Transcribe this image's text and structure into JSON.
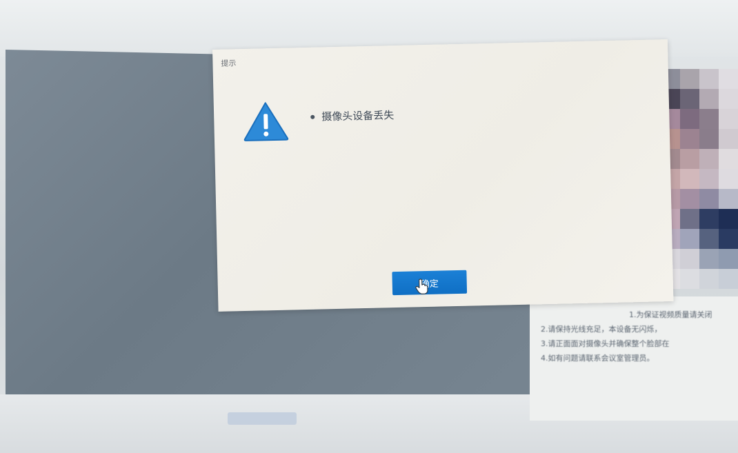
{
  "dialog": {
    "title": "提示",
    "message": "摄像头设备丢失",
    "ok_button_label": "确定",
    "warning_icon": "warning-triangle-icon",
    "accent_color": "#1a7fd6"
  },
  "background": {
    "notes": [
      "1.为保证视频质量请关闭",
      "2.请保持光线充足，本设备无闪烁，",
      "3.请正面面对摄像头并确保整个脸部在",
      "4.如有问题请联系会议室管理员。"
    ]
  },
  "mosaic_colors": [
    [
      "#7c7f8e",
      "#8d8e9a",
      "#a9a4ab",
      "#c9c4cb",
      "#e0dde2"
    ],
    [
      "#8f7f86",
      "#4a4556",
      "#6b6576",
      "#b3aab3",
      "#dcd8dd"
    ],
    [
      "#b89a97",
      "#a5899c",
      "#7d6b7f",
      "#8b7e8c",
      "#d8d3d8"
    ],
    [
      "#c8a59e",
      "#b7928f",
      "#9c8391",
      "#8a7d8b",
      "#d0cad0"
    ],
    [
      "#c9a7a2",
      "#a28a8f",
      "#b99ea3",
      "#bfb0b8",
      "#e0dcdf"
    ],
    [
      "#b89ba0",
      "#c4a5a7",
      "#d2b8bb",
      "#c5b8c2",
      "#dedbe0"
    ],
    [
      "#a98ea3",
      "#b79aa6",
      "#a38fa3",
      "#8f8ba3",
      "#b7b9c8"
    ],
    [
      "#caa8b4",
      "#c0a5b4",
      "#6f7088",
      "#2e3d62",
      "#1e2e55"
    ],
    [
      "#dcd0d8",
      "#b9adc0",
      "#a0a4ba",
      "#56627f",
      "#2a3b62"
    ],
    [
      "#e3dfe3",
      "#d9d7dd",
      "#d0cfd6",
      "#9aa3b5",
      "#8f9bb0"
    ],
    [
      "#e6e4e6",
      "#e3e1e4",
      "#dcdde1",
      "#d0d4da",
      "#c8ced7"
    ]
  ]
}
